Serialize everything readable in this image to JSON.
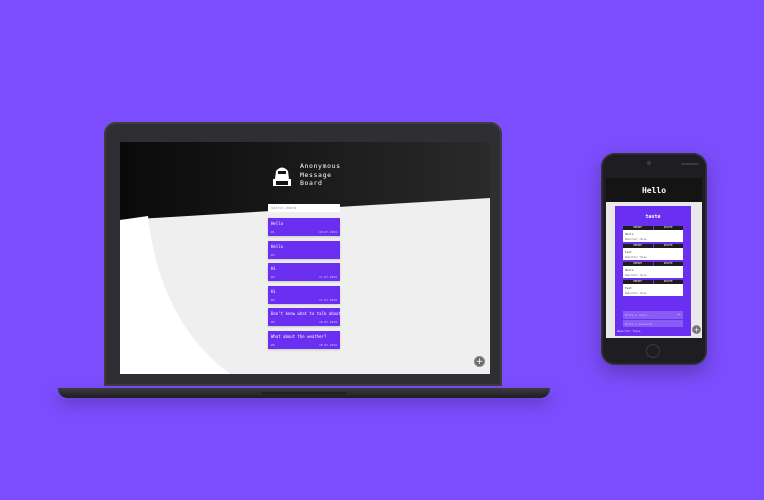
{
  "laptop": {
    "brand": {
      "title": "Anonymous\nMessage\nBoard"
    },
    "search": {
      "placeholder": "Search board"
    },
    "messages": [
      {
        "title": "Hello",
        "id": "#1",
        "date": "10.07.2019"
      },
      {
        "title": "Hello",
        "id": "#2",
        "date": ""
      },
      {
        "title": "Hi",
        "id": "#3",
        "date": "17.07.2019"
      },
      {
        "title": "Hi",
        "id": "#4",
        "date": "17.07.2019"
      },
      {
        "title": "Don't know what to talk about",
        "id": "#5",
        "date": "18.07.2019"
      },
      {
        "title": "What about the weather?",
        "id": "#6",
        "date": "18.07.2019"
      }
    ],
    "fab_label": "+"
  },
  "phone": {
    "header": "Hello",
    "post_title": "taste",
    "replies": [
      {
        "report": "REPORT",
        "delete": "DELETE",
        "text": "Hello",
        "reported": "Reported: false"
      },
      {
        "report": "REPORT",
        "delete": "DELETE",
        "text": "Test",
        "reported": "Reported: false"
      },
      {
        "report": "REPORT",
        "delete": "DELETE",
        "text": "Hello",
        "reported": "Reported: false"
      },
      {
        "report": "REPORT",
        "delete": "DELETE",
        "text": "Test",
        "reported": "Reported: false"
      }
    ],
    "reply_placeholder": "Write a reply...",
    "password_placeholder": "Write a password",
    "footer": "Reported: false",
    "fab_label": "+"
  },
  "colors": {
    "background": "#7c4dfc",
    "card": "#6a2ff0",
    "header_dark": "#141414"
  }
}
